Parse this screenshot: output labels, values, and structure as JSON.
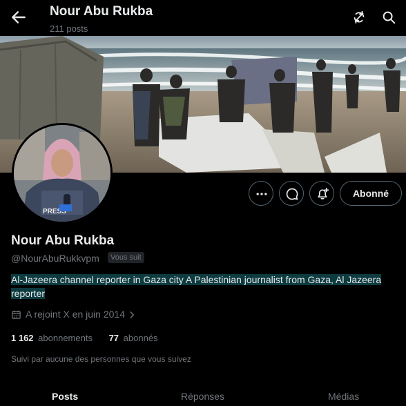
{
  "header": {
    "title": "Nour Abu Rukba",
    "post_count": "211 posts",
    "back_icon": "arrow-left-icon",
    "icons": [
      "refresh-icon",
      "search-icon"
    ]
  },
  "profile": {
    "name": "Nour Abu Rukba",
    "handle": "@NourAbuRukkvpm",
    "follows_you_badge": "Vous suit",
    "bio": "Al-Jazeera channel reporter in Gaza city A Palestinian journalist from Gaza, Al Jazeera reporter",
    "joined": "A rejoint X en juin 2014",
    "following_count": "1 162",
    "following_label": "abonnements",
    "followers_count": "77",
    "followers_label": "abonnés",
    "followed_by": "Suivi par aucune des personnes que vous suivez"
  },
  "actions": {
    "follow_label": "Abonné",
    "icons": [
      "more-icon",
      "message-icon",
      "notification-plus-icon"
    ]
  },
  "tabs": [
    {
      "label": "Posts",
      "active": true
    },
    {
      "label": "Réponses",
      "active": false
    },
    {
      "label": "Médias",
      "active": false
    }
  ],
  "colors": {
    "background": "#000000",
    "text": "#e7e9ea",
    "muted": "#71767b",
    "highlight": "#0d3b40"
  }
}
